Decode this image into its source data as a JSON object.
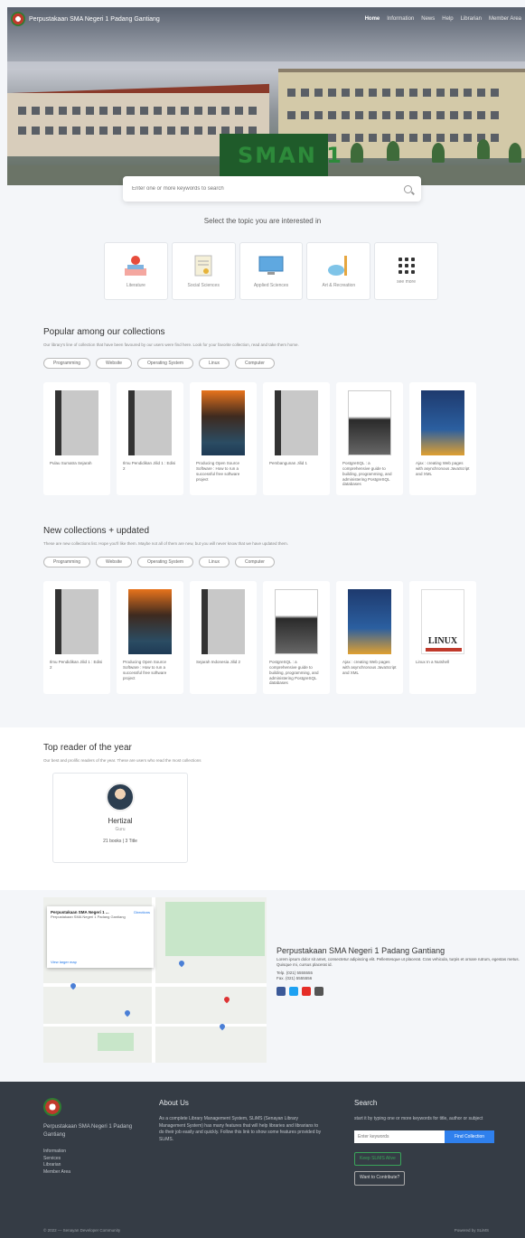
{
  "nav": {
    "brand": "Perpustakaan SMA Negeri 1 Padang Gantiang",
    "links": [
      "Home",
      "Information",
      "News",
      "Help",
      "Librarian",
      "Member Area"
    ]
  },
  "hero": {
    "sign": "SMAN 1"
  },
  "search": {
    "placeholder": "Enter one or more keywords to search"
  },
  "topics": {
    "title": "Select the topic you are interested in",
    "items": [
      {
        "label": "Literature"
      },
      {
        "label": "Social Sciences"
      },
      {
        "label": "Applied Sciences"
      },
      {
        "label": "Art & Recreation"
      },
      {
        "label": "see more"
      }
    ]
  },
  "popular": {
    "title": "Popular among our collections",
    "subtitle": "Our library's line of collection that have been favoured by our users were find here. Look for your favorite collection, read and take them home.",
    "pills": [
      "Programming",
      "Website",
      "Operating System",
      "Linux",
      "Computer"
    ],
    "books": [
      {
        "title": "Pulau Sumatra Sejarah",
        "cover": "gray"
      },
      {
        "title": "Ilmu Pendidikan Jilid 1 : Edisi 2",
        "cover": "gray"
      },
      {
        "title": "Producing Open Source Software : How to run a successful free software project",
        "cover": "orange"
      },
      {
        "title": "Pembangunan Jilid 1",
        "cover": "gray"
      },
      {
        "title": "PostgreSQL : a comprehensive guide to building, programming, and administering PostgreSQL databases",
        "cover": "pg"
      },
      {
        "title": "Ajax : creating Web pages with asynchronous JavaScript and XML",
        "cover": "blue"
      }
    ]
  },
  "newest": {
    "title": "New collections + updated",
    "subtitle": "These are new collections list. Hope you'll like them. Maybe not all of them are new, but you will never know that we have updated them.",
    "pills": [
      "Programming",
      "Website",
      "Operating System",
      "Linux",
      "Computer"
    ],
    "books": [
      {
        "title": "Ilmu Pendidikan Jilid 1 : Edisi 2",
        "cover": "gray"
      },
      {
        "title": "Producing Open Source Software : How to run a successful free software project",
        "cover": "orange"
      },
      {
        "title": "Sejarah Indonesia Jilid 2",
        "cover": "gray"
      },
      {
        "title": "PostgreSQL : a comprehensive guide to building, programming, and administering PostgreSQL databases",
        "cover": "pg"
      },
      {
        "title": "Ajax : creating Web pages with asynchronous JavaScript and XML",
        "cover": "blue"
      },
      {
        "title": "Linux In a Nutshell",
        "cover": "linux",
        "cover_text": "LINUX"
      }
    ]
  },
  "reader": {
    "title": "Top reader of the year",
    "subtitle": "Our best and prolific readers of the year. These are users who read the most collections",
    "name": "Hertizal",
    "role": "Guru",
    "stats": "21 books  |  3 Title"
  },
  "map": {
    "popup_title": "Perpustakaan SMA Negeri 1 ...",
    "popup_text": "Perpustakaan SMA Negeri 1 Padang Gantiang",
    "directions": "Directions",
    "link": "View larger map"
  },
  "contact": {
    "name": "Perpustakaan SMA Negeri 1 Padang Gantiang",
    "desc": "Lorem ipsum dolor sit amet, consectetur adipiscing elit. Pellentesque ut placerat. Cras vehicula, turpis et ornare rutrum, egestas metus. Quisque mi, cursus placerat id.",
    "tel": "Telp. (021) 5555555",
    "fax": "Fax. (021) 5555556"
  },
  "footer": {
    "brand": "Perpustakaan SMA Negeri 1 Padang Gantiang",
    "links": [
      "Information",
      "Services",
      "Librarian",
      "Member Area"
    ],
    "about_title": "About Us",
    "about_text": "As a complete Library Management System, SLiMS (Senayan Library Management System) has many features that will help libraries and librarians to do their job easily and quickly. Follow this link to show some features provided by SLiMS.",
    "search_title": "Search",
    "search_text": "start it by typing one or more keywords for title, author or subject",
    "search_placeholder": "Enter keywords",
    "search_button": "Find Collection",
    "donate_button": "Keep SLiMS Alive",
    "contribute_button": "Want to Contribute?",
    "copyright": "© 2022 — Senayan Developer Community",
    "powered": "Powered by SLiMS"
  },
  "colors": {
    "accent": "#2f80ed",
    "footer_bg": "#353c45",
    "facebook": "#3b5998",
    "twitter": "#1da1f2",
    "youtube": "#e52d27",
    "instagram": "#555555"
  }
}
